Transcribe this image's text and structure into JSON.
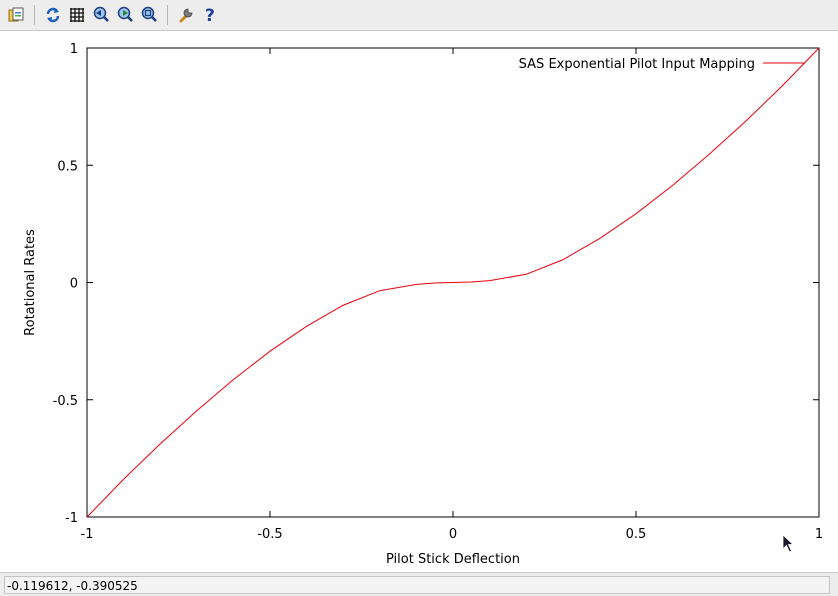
{
  "toolbar": {
    "buttons": [
      {
        "name": "copy-clipboard-icon"
      },
      {
        "name": "replot-icon"
      },
      {
        "name": "grid-icon"
      },
      {
        "name": "previous-zoom-icon"
      },
      {
        "name": "next-zoom-icon"
      },
      {
        "name": "autoscale-icon"
      },
      {
        "name": "configuration-icon"
      },
      {
        "name": "help-icon"
      }
    ],
    "help_glyph": "?"
  },
  "status": {
    "coords": "-0.119612, -0.390525"
  },
  "chart_data": {
    "type": "line",
    "title": "",
    "xlabel": "Pilot Stick Deflection",
    "ylabel": "Rotational Rates",
    "xlim": [
      -1,
      1
    ],
    "ylim": [
      -1,
      1
    ],
    "xticks": [
      -1,
      -0.5,
      0,
      0.5,
      1
    ],
    "yticks": [
      -1,
      -0.5,
      0,
      0.5,
      1
    ],
    "xtick_labels": [
      "-1",
      "-0.5",
      "0",
      "0.5",
      "1"
    ],
    "ytick_labels": [
      "-1",
      "-0.5",
      "0",
      "0.5",
      "1"
    ],
    "grid": false,
    "legend_position": "top-right",
    "series": [
      {
        "name": "SAS Exponential Pilot Input Mapping",
        "color": "#e8000b",
        "x": [
          -1,
          -0.9,
          -0.8,
          -0.7,
          -0.6,
          -0.5,
          -0.4,
          -0.3,
          -0.2,
          -0.1,
          -0.05,
          0,
          0.05,
          0.1,
          0.2,
          0.3,
          0.4,
          0.5,
          0.6,
          0.7,
          0.8,
          0.9,
          1
        ],
        "y": [
          -1,
          -0.839,
          -0.688,
          -0.547,
          -0.414,
          -0.293,
          -0.187,
          -0.097,
          -0.035,
          -0.008,
          -0.002,
          0,
          0.002,
          0.008,
          0.035,
          0.097,
          0.187,
          0.293,
          0.414,
          0.547,
          0.688,
          0.839,
          1
        ]
      }
    ]
  }
}
